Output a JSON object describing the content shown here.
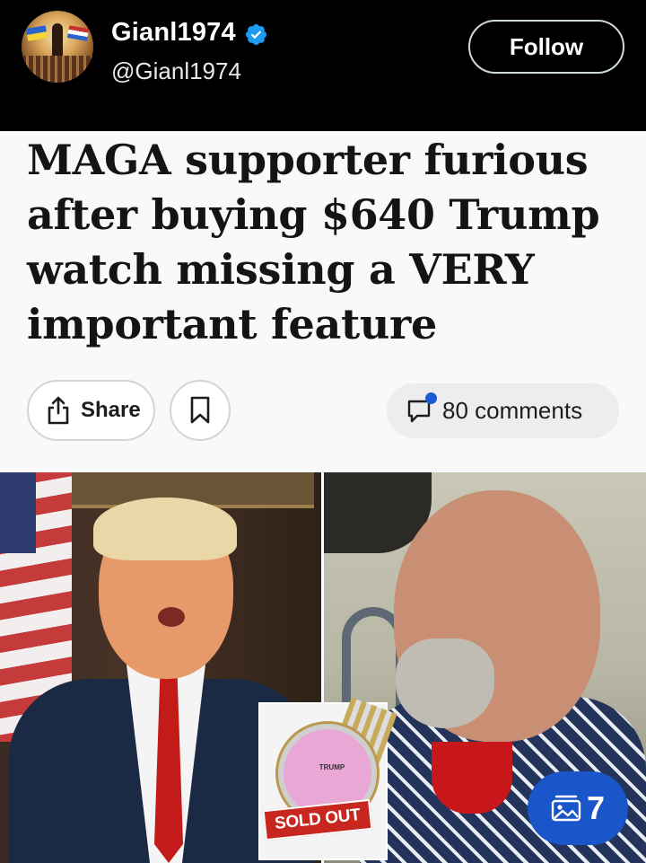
{
  "post": {
    "display_name": "Gianl1974",
    "handle": "@Gianl1974",
    "verified": true,
    "follow_label": "Follow"
  },
  "article": {
    "headline": "MAGA supporter furious after buying $640 Trump watch missing a VERY important feature",
    "share_label": "Share",
    "comments_label": "80 comments"
  },
  "media": {
    "inset_watch_brand": "TRUMP",
    "inset_stamp": "SOLD OUT",
    "gallery_count": "7"
  },
  "icons": {
    "verified": "verified-badge-icon",
    "share": "share-icon",
    "bookmark": "bookmark-icon",
    "comments": "comment-bubble-icon",
    "gallery": "photo-gallery-icon"
  },
  "colors": {
    "header_bg": "#000000",
    "card_bg": "#f9f9fa",
    "verified_blue": "#1d9bf0",
    "notification_dot": "#1a5ad7",
    "gallery_badge": "#1a55c9",
    "sold_out_red": "#c8271f"
  }
}
